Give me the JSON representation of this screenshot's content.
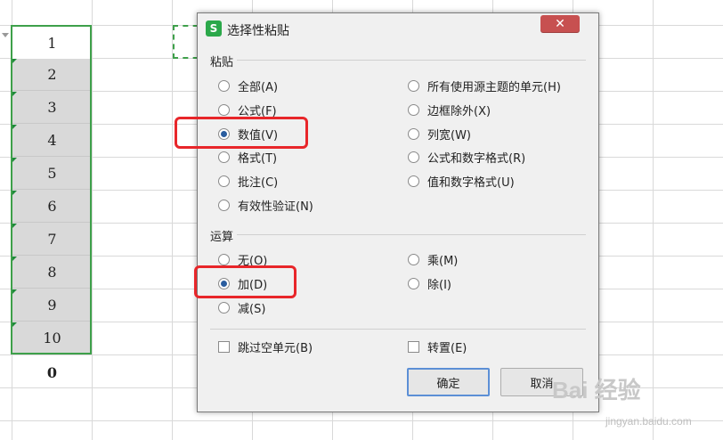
{
  "dialog": {
    "title": "选择性粘贴",
    "app_icon": "S",
    "close_label": "✕",
    "paste_group": "粘贴",
    "paste_left": [
      "全部(A)",
      "公式(F)",
      "数值(V)",
      "格式(T)",
      "批注(C)",
      "有效性验证(N)"
    ],
    "paste_right": [
      "所有使用源主题的单元(H)",
      "边框除外(X)",
      "列宽(W)",
      "公式和数字格式(R)",
      "值和数字格式(U)"
    ],
    "paste_selected": "数值(V)",
    "op_group": "运算",
    "op_left": [
      "无(O)",
      "加(D)",
      "减(S)"
    ],
    "op_right": [
      "乘(M)",
      "除(I)"
    ],
    "op_selected": "加(D)",
    "skip_blanks": "跳过空单元(B)",
    "transpose": "转置(E)",
    "ok": "确定",
    "cancel": "取消"
  },
  "sheet": {
    "values": [
      "1",
      "2",
      "3",
      "4",
      "5",
      "6",
      "7",
      "8",
      "9",
      "10"
    ],
    "sum": "0",
    "accent": "#3ea04a"
  },
  "watermark": {
    "brand": "Bai 经验",
    "site": "jingyan.baidu.com"
  }
}
